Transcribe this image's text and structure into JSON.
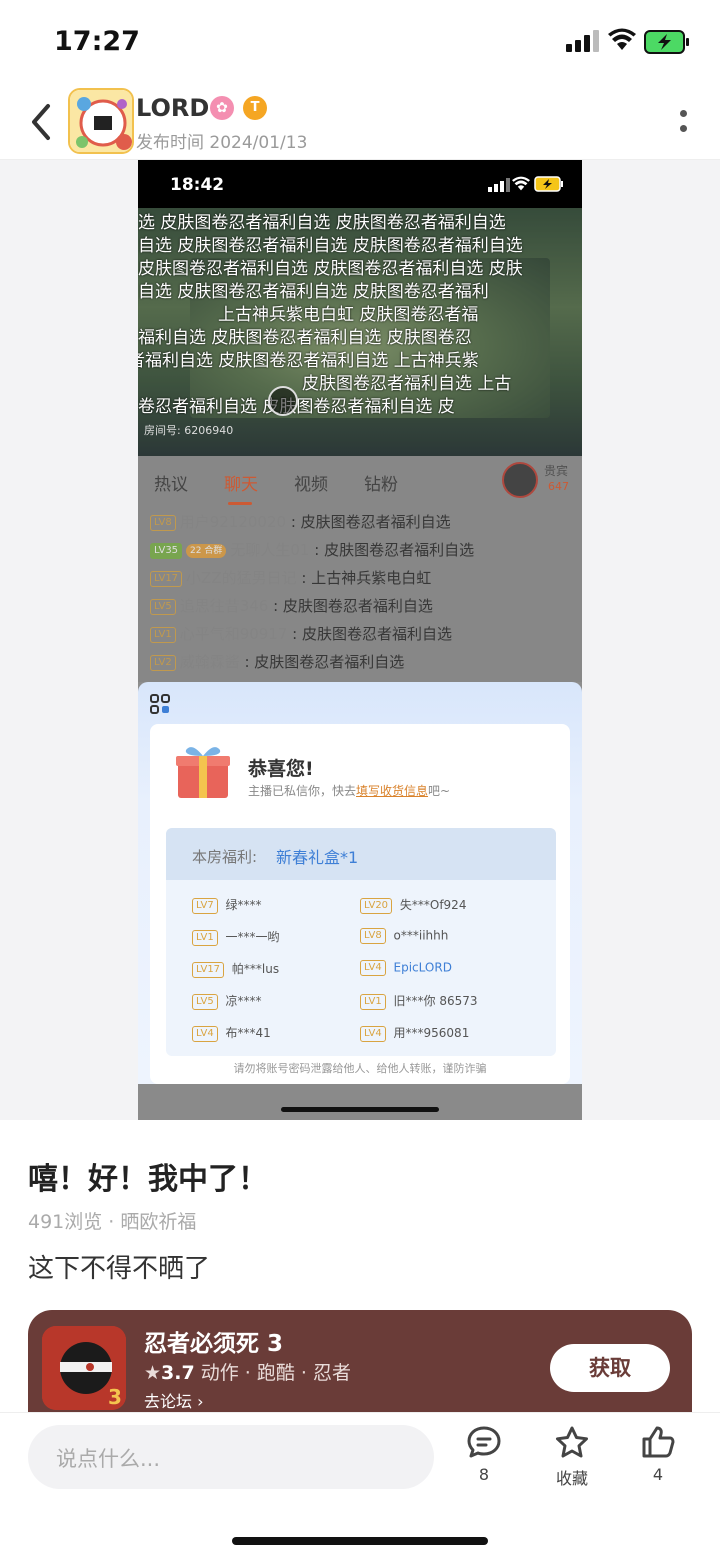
{
  "status_bar": {
    "time": "17:27"
  },
  "header": {
    "username": "LORD",
    "publish_time": "发布时间 2024/01/13"
  },
  "screenshot": {
    "time": "18:42",
    "danmaku": [
      "选  皮肤图卷忍者福利自选  皮肤图卷忍者福利自选",
      "自选  皮肤图卷忍者福利自选  皮肤图卷忍者福利自选",
      "皮肤图卷忍者福利自选  皮肤图卷忍者福利自选  皮肤",
      "自选  皮肤图卷忍者福利自选  皮肤图卷忍者福利",
      "上古神兵紫电白虹          皮肤图卷忍者福",
      "福利自选      皮肤图卷忍者福利自选    皮肤图卷忍",
      "者福利自选      皮肤图卷忍者福利自选    上古神兵紫",
      "皮肤图卷忍者福利自选        上古",
      "卷忍者福利自选    皮肤图卷忍者福利自选    皮"
    ],
    "watermark": "房间号: 6206940",
    "tabs": [
      "热议",
      "聊天",
      "视频",
      "钻粉"
    ],
    "active_tab": "聊天",
    "guest_label": "贵宾",
    "guest_count": "647",
    "chat": [
      {
        "lv": "LV8",
        "fan": "",
        "user": "用户92120020",
        "msg": "皮肤图卷忍者福利自选"
      },
      {
        "lv": "LV35",
        "fan": "22  合群",
        "user": "无聊人生01",
        "msg": "皮肤图卷忍者福利自选"
      },
      {
        "lv": "LV17",
        "fan": "",
        "user": "小ZZ的猛男日记",
        "msg": "上古神兵紫电白虹"
      },
      {
        "lv": "LV5",
        "fan": "",
        "user": "追思往昔346",
        "msg": "皮肤图卷忍者福利自选"
      },
      {
        "lv": "LV1",
        "fan": "",
        "user": "心平气和90917",
        "msg": "皮肤图卷忍者福利自选"
      },
      {
        "lv": "LV2",
        "fan": "",
        "user": "威翰霖酱",
        "msg": "皮肤图卷忍者福利自选"
      }
    ],
    "popup": {
      "title": "恭喜您!",
      "sub_prefix": "主播已私信你，快去",
      "sub_link": "填写收货信息",
      "sub_suffix": "吧~",
      "welfare_label": "本房福利:",
      "welfare_value": "新春礼盒*1",
      "winners": [
        {
          "lv": "LV7",
          "name": "绿****"
        },
        {
          "lv": "LV20",
          "name": "失***Of924"
        },
        {
          "lv": "LV1",
          "name": "一***一哟"
        },
        {
          "lv": "LV8",
          "name": "o***iihhh"
        },
        {
          "lv": "LV17",
          "name": "帕***lus"
        },
        {
          "lv": "LV4",
          "name": "EpicLORD"
        },
        {
          "lv": "LV5",
          "name": "凉****"
        },
        {
          "lv": "LV1",
          "name": "旧***你 86573"
        },
        {
          "lv": "LV4",
          "name": "布***41"
        },
        {
          "lv": "LV4",
          "name": "用***956081"
        }
      ],
      "warning": "请勿将账号密码泄露给他人、给他人转账，谨防诈骗"
    }
  },
  "post": {
    "title": "嘻！好！我中了！",
    "meta": "491浏览 · 晒欧祈福",
    "body": "这下不得不晒了"
  },
  "game": {
    "name": "忍者必须死 3",
    "rating": "3.7",
    "tags": "动作 · 跑酷 · 忍者",
    "forum": "去论坛",
    "get_label": "获取",
    "accent": "#6a3c38"
  },
  "bottom_bar": {
    "placeholder": "说点什么...",
    "comment_count": "8",
    "favorite_label": "收藏",
    "like_count": "4"
  }
}
